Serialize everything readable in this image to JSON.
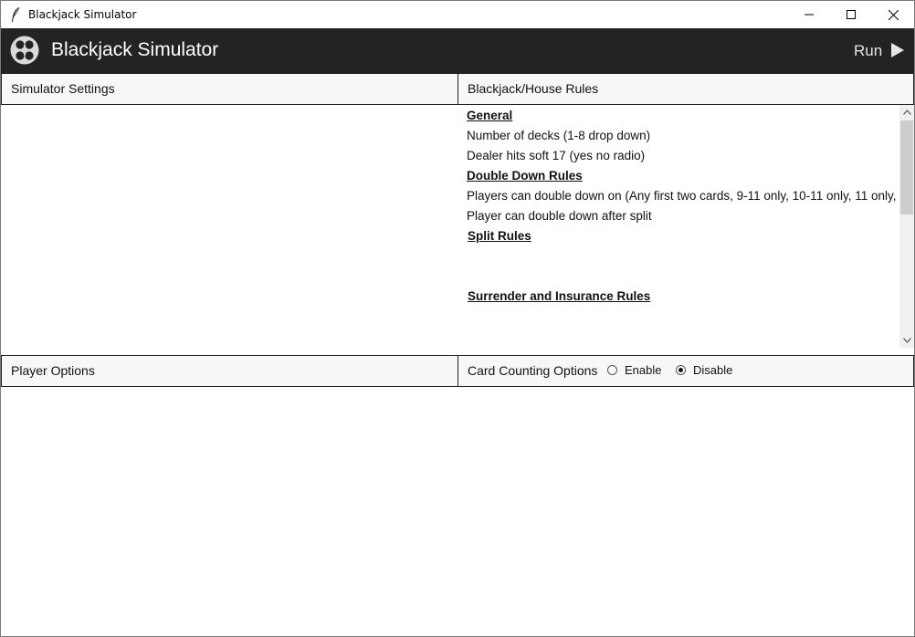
{
  "window": {
    "title": "Blackjack Simulator"
  },
  "header": {
    "title": "Blackjack Simulator",
    "run_label": "Run",
    "background": "#232323"
  },
  "panels": {
    "simulator_settings": "Simulator Settings",
    "house_rules": "Blackjack/House Rules",
    "player_options": "Player Options",
    "card_counting": "Card Counting Options"
  },
  "rules": {
    "general_heading": "General",
    "decks": "Number of decks (1-8 drop down)",
    "dealer_soft17": "Dealer hits soft 17 (yes no radio)",
    "double_heading": "Double Down Rules",
    "double_cards": "Players can double down on (Any first two cards,  9-11 only,  10-11 only, 11 only,",
    "double_after_split": "Player can double down after split",
    "split_heading": "Split Rules",
    "surrender_heading": "Surrender and Insurance Rules"
  },
  "card_counting": {
    "options": [
      "Enable",
      "Disable"
    ],
    "selected": "Disable"
  },
  "icons": {
    "app": "feather-icon",
    "logo": "card-suits-logo-icon",
    "run": "play-icon"
  }
}
